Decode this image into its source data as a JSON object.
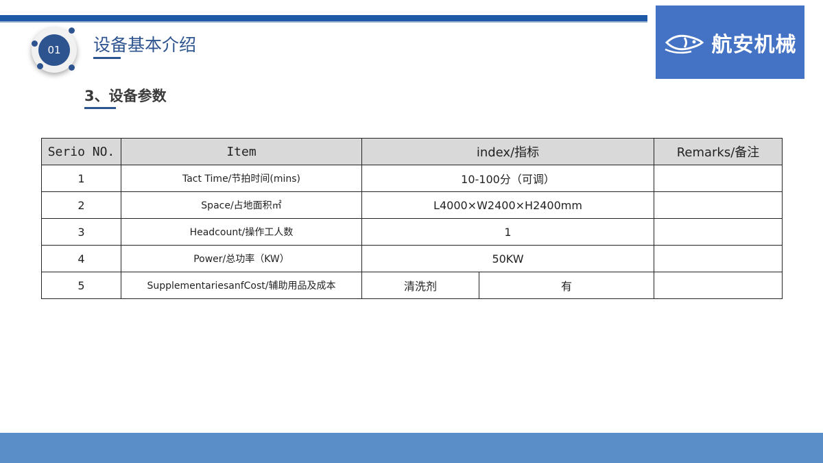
{
  "header": {
    "badge_number": "01",
    "section_title": "设备基本介绍",
    "subtitle": "3、设备参数"
  },
  "logo": {
    "brand_text": "航安机械"
  },
  "table": {
    "columns": [
      "Serio NO.",
      "Item",
      "index/指标",
      "Remarks/备注"
    ],
    "rows": [
      {
        "no": "1",
        "item": "Tact Time/节拍时间(mins)",
        "value": "10-100分（可调）",
        "remarks": ""
      },
      {
        "no": "2",
        "item": "Space/占地面积㎡",
        "value": "L4000×W2400×H2400mm",
        "remarks": ""
      },
      {
        "no": "3",
        "item": "Headcount/操作工人数",
        "value": "1",
        "remarks": ""
      },
      {
        "no": "4",
        "item": "Power/总功率（KW）",
        "value": "50KW",
        "remarks": ""
      },
      {
        "no": "5",
        "item": "SupplementariesanfCost/辅助用品及成本",
        "value_a": "清洗剂",
        "value_b": "有",
        "remarks": ""
      }
    ]
  },
  "colors": {
    "primary": "#2e5490",
    "top_bar": "#1f5aa8",
    "bottom_bar": "#5a8ec8",
    "logo_bg": "#4472c4",
    "header_bg": "#d9d9d9"
  }
}
